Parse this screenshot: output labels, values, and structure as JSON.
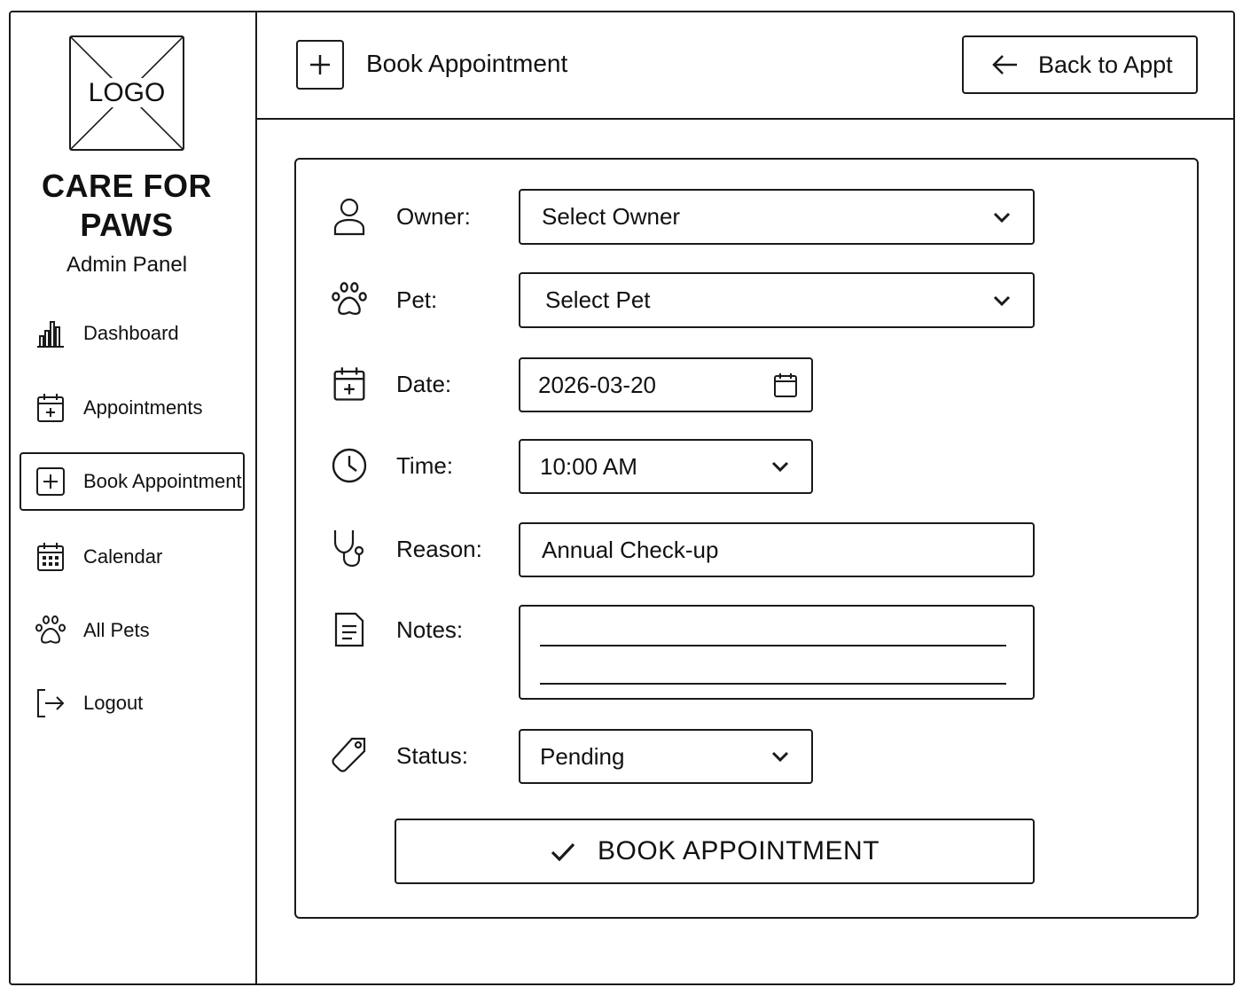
{
  "logo": {
    "text": "LOGO"
  },
  "brand": {
    "line1": "CARE FOR",
    "line2": "PAWS",
    "subtitle": "Admin Panel"
  },
  "sidebar": {
    "items": [
      {
        "label": "Dashboard",
        "icon": "bar-chart-icon"
      },
      {
        "label": "Appointments",
        "icon": "calendar-plus-icon"
      },
      {
        "label": "Book Appointment",
        "icon": "plus-box-icon",
        "active": true
      },
      {
        "label": "Calendar",
        "icon": "calendar-grid-icon"
      },
      {
        "label": "All Pets",
        "icon": "paw-icon"
      },
      {
        "label": "Logout",
        "icon": "logout-icon"
      }
    ]
  },
  "header": {
    "title": "Book Appointment",
    "back_label": "Back to Appt"
  },
  "form": {
    "owner": {
      "label": "Owner:",
      "value": "Select Owner"
    },
    "pet": {
      "label": "Pet:",
      "value": "Select Pet"
    },
    "date": {
      "label": "Date:",
      "value": "2026-03-20"
    },
    "time": {
      "label": "Time:",
      "value": "10:00 AM"
    },
    "reason": {
      "label": "Reason:",
      "value": "Annual Check-up"
    },
    "notes": {
      "label": "Notes:",
      "value": ""
    },
    "status": {
      "label": "Status:",
      "value": "Pending"
    },
    "submit_label": "BOOK APPOINTMENT"
  }
}
